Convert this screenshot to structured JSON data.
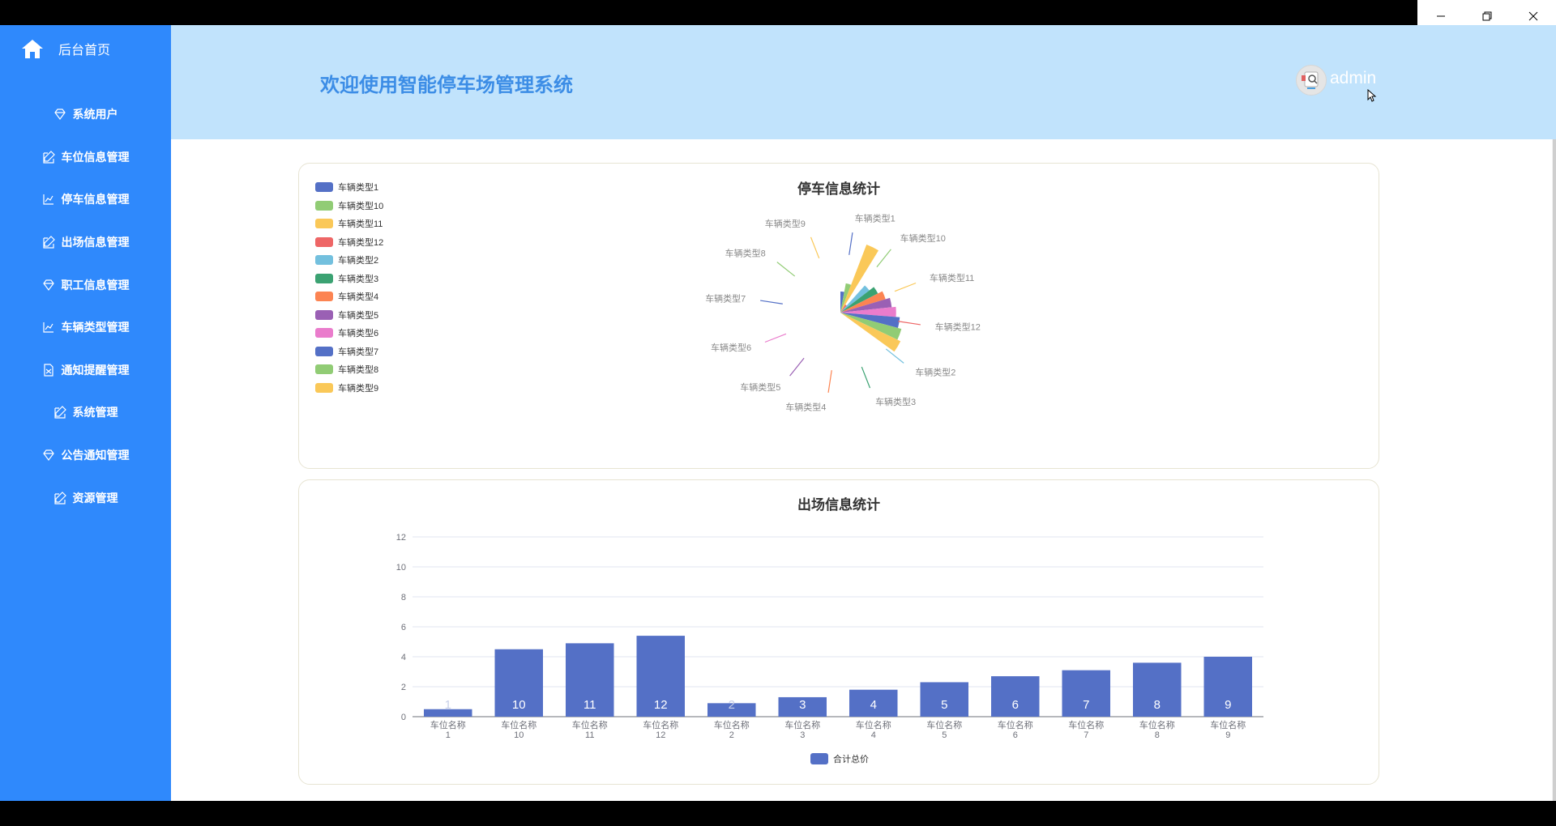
{
  "sidebar": {
    "home_label": "后台首页",
    "items": [
      {
        "label": "系统用户",
        "icon": "diamond-icon"
      },
      {
        "label": "车位信息管理",
        "icon": "edit-icon"
      },
      {
        "label": "停车信息管理",
        "icon": "chart-icon"
      },
      {
        "label": "出场信息管理",
        "icon": "edit-icon"
      },
      {
        "label": "职工信息管理",
        "icon": "diamond-icon"
      },
      {
        "label": "车辆类型管理",
        "icon": "chart-icon"
      },
      {
        "label": "通知提醒管理",
        "icon": "document-icon"
      },
      {
        "label": "系统管理",
        "icon": "edit-icon"
      },
      {
        "label": "公告通知管理",
        "icon": "diamond-icon"
      },
      {
        "label": "资源管理",
        "icon": "edit-icon"
      }
    ],
    "colors": {
      "bg": "#2f89fc"
    }
  },
  "header": {
    "welcome": "欢迎使用智能停车场管理系统",
    "username": "admin",
    "colors": {
      "bg": "#c1e3fc",
      "title": "#3c8de6"
    }
  },
  "chart_data": [
    {
      "type": "pie",
      "subtype": "rose",
      "title": "停车信息统计",
      "legend_position": "top-left",
      "categories": [
        "车辆类型1",
        "车辆类型10",
        "车辆类型11",
        "车辆类型12",
        "车辆类型2",
        "车辆类型3",
        "车辆类型4",
        "车辆类型5",
        "车辆类型6",
        "车辆类型7",
        "车辆类型8",
        "车辆类型9"
      ],
      "values": [
        1,
        2,
        12,
        0.2,
        3,
        4,
        5,
        6,
        7,
        8,
        9,
        10
      ],
      "colors": [
        "#5470c6",
        "#91cc75",
        "#fac858",
        "#ee6666",
        "#73c0de",
        "#3ba272",
        "#fc8452",
        "#9a60b4",
        "#ea7ccc",
        "#5470c6",
        "#91cc75",
        "#fac858"
      ]
    },
    {
      "type": "bar",
      "title": "出场信息统计",
      "categories": [
        [
          "车位名称",
          "1"
        ],
        [
          "车位名称",
          "10"
        ],
        [
          "车位名称",
          "11"
        ],
        [
          "车位名称",
          "12"
        ],
        [
          "车位名称",
          "2"
        ],
        [
          "车位名称",
          "3"
        ],
        [
          "车位名称",
          "4"
        ],
        [
          "车位名称",
          "5"
        ],
        [
          "车位名称",
          "6"
        ],
        [
          "车位名称",
          "7"
        ],
        [
          "车位名称",
          "8"
        ],
        [
          "车位名称",
          "9"
        ]
      ],
      "series": [
        {
          "name": "合计总价",
          "values": [
            0.5,
            4.5,
            4.9,
            5.4,
            0.9,
            1.3,
            1.8,
            2.3,
            2.7,
            3.1,
            3.6,
            4.0
          ],
          "labels": [
            "1",
            "10",
            "11",
            "12",
            "2",
            "3",
            "4",
            "5",
            "6",
            "7",
            "8",
            "9"
          ],
          "color": "#5470c6"
        }
      ],
      "yticks": [
        "0",
        "2",
        "4",
        "6",
        "8",
        "10",
        "12"
      ],
      "ylim": [
        0,
        12
      ],
      "legend_position": "bottom-center",
      "grid": true
    }
  ]
}
